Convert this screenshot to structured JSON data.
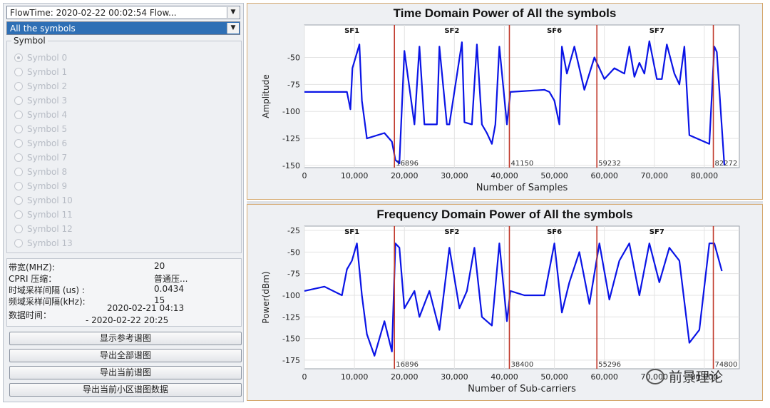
{
  "selectors": {
    "flowtime": "FlowTime: 2020-02-22 00:02:54  Flow...",
    "symbols": "All the symbols"
  },
  "symbol_group": {
    "title": "Symbol",
    "options": [
      "Symbol 0",
      "Symbol 1",
      "Symbol 2",
      "Symbol 3",
      "Symbol 4",
      "Symbol 5",
      "Symbol 6",
      "Symbol 7",
      "Symbol 8",
      "Symbol 9",
      "Symbol 10",
      "Symbol 11",
      "Symbol 12",
      "Symbol 13"
    ],
    "selected": "Symbol 0"
  },
  "info": {
    "bandwidth_label": "带宽(MHZ):",
    "bandwidth_value": "20",
    "cpri_label": "CPRI 压缩：",
    "cpri_value": "普通压...",
    "time_interval_label": "时域采样间隔 (us) :",
    "time_interval_value": "0.0434",
    "freq_interval_label": "频域采样间隔(kHz):",
    "freq_interval_value": "15",
    "data_time_label": "数据时间：",
    "data_time_start": "2020-02-21 04:13",
    "data_time_end": "- 2020-02-22 20:25"
  },
  "buttons": {
    "show_ref": "显示参考谱图",
    "export_all": "导出全部谱图",
    "export_current": "导出当前谱图",
    "export_cell": "导出当前小区谱图数据"
  },
  "watermark": {
    "text": "前景理论"
  },
  "colors": {
    "trace": "#0a14e6",
    "marker": "#c0392b",
    "plot_bg": "#ffffff",
    "panel_border": "#d5a86d"
  },
  "chart_data": [
    {
      "type": "line",
      "title": "Time Domain Power of All the symbols",
      "xlabel": "Number of Samples",
      "ylabel": "Amplitude",
      "xlim": [
        0,
        87000
      ],
      "ylim": [
        -152,
        -20
      ],
      "xticks": [
        0,
        10000,
        20000,
        30000,
        40000,
        50000,
        60000,
        70000,
        80000
      ],
      "xtick_labels": [
        "0",
        "10,000",
        "20,000",
        "30,000",
        "40,000",
        "50,000",
        "60,000",
        "70,000",
        "80,000"
      ],
      "yticks": [
        -150,
        -125,
        -100,
        -75,
        -50
      ],
      "markers": [
        {
          "x": 18000,
          "label": "16896"
        },
        {
          "x": 41000,
          "label": "41150"
        },
        {
          "x": 58500,
          "label": "59232"
        },
        {
          "x": 81800,
          "label": "82272"
        }
      ],
      "sf_labels": [
        {
          "x": 9500,
          "label": "SF1"
        },
        {
          "x": 29500,
          "label": "SF2"
        },
        {
          "x": 50000,
          "label": "SF6"
        },
        {
          "x": 70500,
          "label": "SF7"
        }
      ],
      "series": [
        {
          "x": [
            0,
            7500,
            8500,
            9200,
            9600,
            11000,
            11500,
            12500,
            16000,
            17500,
            18200,
            19000,
            20000,
            22000,
            23000,
            24000,
            26500,
            27000,
            28500,
            29000,
            31500,
            32000,
            33500,
            34500,
            35500,
            36500,
            37500,
            38200,
            39000,
            40500,
            41200,
            48000,
            49000,
            50000,
            51000,
            51500,
            52500,
            54000,
            56000,
            58000,
            60000,
            62000,
            64000,
            65000,
            66000,
            67000,
            68000,
            69000,
            70500,
            71500,
            72500,
            74000,
            75000,
            76000,
            77000,
            81000,
            82000,
            82500,
            84000
          ],
          "y": [
            -82,
            -82,
            -82,
            -98,
            -60,
            -38,
            -90,
            -125,
            -120,
            -128,
            -145,
            -148,
            -44,
            -112,
            -40,
            -112,
            -112,
            -40,
            -112,
            -112,
            -36,
            -110,
            -112,
            -38,
            -112,
            -120,
            -130,
            -112,
            -40,
            -112,
            -82,
            -80,
            -82,
            -90,
            -112,
            -40,
            -65,
            -40,
            -80,
            -50,
            -70,
            -60,
            -65,
            -40,
            -68,
            -55,
            -65,
            -35,
            -70,
            -70,
            -38,
            -65,
            -75,
            -40,
            -122,
            -130,
            -40,
            -45,
            -150
          ]
        }
      ]
    },
    {
      "type": "line",
      "title": "Frequency Domain Power of All the symbols",
      "xlabel": "Number of Sub-carriers",
      "ylabel": "Power(dBm)",
      "xlim": [
        0,
        87000
      ],
      "ylim": [
        -185,
        -20
      ],
      "xticks": [
        0,
        10000,
        20000,
        30000,
        40000,
        50000,
        60000,
        70000,
        80000
      ],
      "xtick_labels": [
        "0",
        "10,000",
        "20,000",
        "30,000",
        "40,000",
        "50,000",
        "60,000",
        "70,000",
        "80,000"
      ],
      "yticks": [
        -175,
        -150,
        -125,
        -100,
        -75,
        -50,
        -25
      ],
      "markers": [
        {
          "x": 18000,
          "label": "16896"
        },
        {
          "x": 41000,
          "label": "38400"
        },
        {
          "x": 58500,
          "label": "55296"
        },
        {
          "x": 81800,
          "label": "74800"
        }
      ],
      "sf_labels": [
        {
          "x": 9500,
          "label": "SF1"
        },
        {
          "x": 29500,
          "label": "SF2"
        },
        {
          "x": 50000,
          "label": "SF6"
        },
        {
          "x": 70500,
          "label": "SF7"
        }
      ],
      "series": [
        {
          "x": [
            0,
            4000,
            7500,
            8500,
            9500,
            10500,
            11500,
            12500,
            14000,
            16000,
            17500,
            18200,
            19000,
            20000,
            22000,
            23000,
            25000,
            27000,
            29000,
            31000,
            32500,
            34000,
            35500,
            37500,
            39000,
            40500,
            41200,
            44000,
            48000,
            50000,
            51500,
            53000,
            55000,
            57000,
            59000,
            61000,
            63000,
            65000,
            67000,
            69000,
            71000,
            73000,
            75000,
            77000,
            79000,
            81000,
            82000,
            83500
          ],
          "y": [
            -95,
            -90,
            -100,
            -70,
            -60,
            -40,
            -100,
            -145,
            -170,
            -130,
            -165,
            -40,
            -45,
            -115,
            -95,
            -125,
            -95,
            -140,
            -45,
            -115,
            -95,
            -45,
            -125,
            -135,
            -40,
            -130,
            -95,
            -100,
            -100,
            -40,
            -120,
            -85,
            -50,
            -110,
            -40,
            -105,
            -60,
            -40,
            -100,
            -40,
            -85,
            -45,
            -60,
            -155,
            -140,
            -40,
            -40,
            -72
          ]
        }
      ]
    }
  ]
}
